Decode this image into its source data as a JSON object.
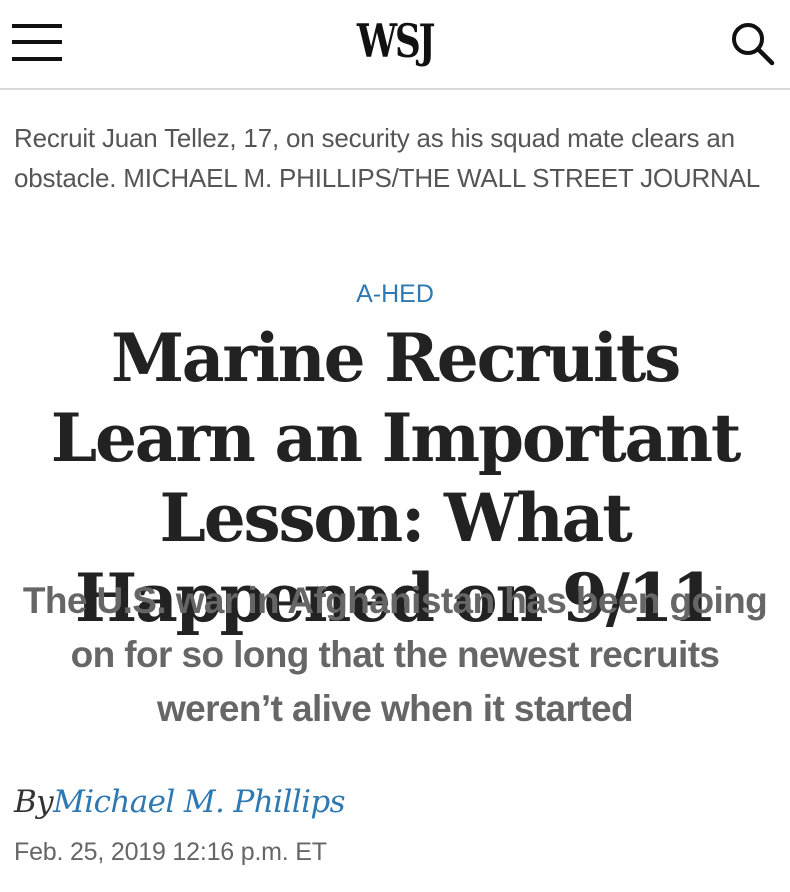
{
  "header": {
    "logo": "WSJ",
    "menu_icon": "hamburger-menu-icon",
    "search_icon": "search-icon"
  },
  "photo": {
    "caption": "Recruit Juan Tellez, 17, on security as his squad mate clears an obstacle.",
    "credit": "MICHAEL M. PHILLIPS/THE WALL STREET JOURNAL"
  },
  "article": {
    "flashline": "A-HED",
    "headline": "Marine Recruits Learn an Important Lesson: What Happened on 9/11",
    "dek": "The U.S. war in Afghanistan has been going on for so long that the newest recruits weren’t alive when it started",
    "byline_prefix": "By",
    "author": "Michael M. Phillips",
    "timestamp": "Feb. 25, 2019 12:16 p.m. ET"
  },
  "colors": {
    "accent": "#2e79b2",
    "text": "#222222",
    "muted": "#666666",
    "divider": "#d9d9d9"
  }
}
